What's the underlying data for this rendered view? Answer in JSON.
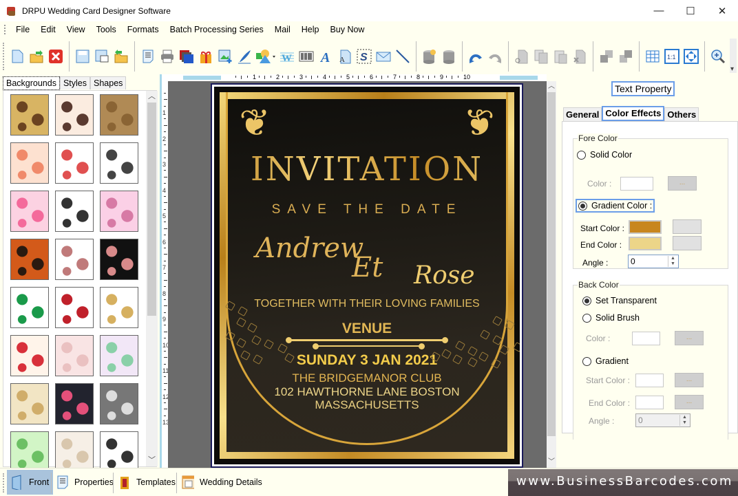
{
  "window": {
    "title": "DRPU Wedding Card Designer Software",
    "controls": {
      "minimize": "—",
      "maximize": "☐",
      "close": "✕"
    }
  },
  "menu": [
    "File",
    "Edit",
    "View",
    "Tools",
    "Formats",
    "Batch Processing Series",
    "Mail",
    "Help",
    "Buy Now"
  ],
  "toolbar": {
    "groups": [
      [
        "new-icon",
        "open-icon",
        "close-icon"
      ],
      [
        "save-icon",
        "save-as-icon",
        "export-icon"
      ],
      [
        "properties-icon",
        "print-icon",
        "print-batch-icon",
        "gift-icon",
        "insert-image-icon",
        "signature-icon",
        "shapes-icon",
        "watermark-icon",
        "barcode-icon",
        "text-icon",
        "text-file-icon",
        "symbol-icon",
        "email-icon",
        "line-icon"
      ],
      [
        "database-icon",
        "database-list-icon"
      ],
      [
        "undo-icon",
        "redo-icon"
      ],
      [
        "cut-icon",
        "copy-icon",
        "paste-icon",
        "delete-icon"
      ],
      [
        "bring-front-icon",
        "send-back-icon"
      ],
      [
        "grid-icon",
        "actual-size-icon",
        "fit-window-icon"
      ],
      [
        "zoom-in-icon"
      ]
    ]
  },
  "left_panel": {
    "tabs": [
      "Backgrounds",
      "Styles",
      "Shapes"
    ],
    "active_tab": "Backgrounds",
    "thumbnails": [
      {
        "name": "butterfly-gold",
        "colors": [
          "#d8b463",
          "#6b4320"
        ]
      },
      {
        "name": "paisley-lace",
        "colors": [
          "#fbece0",
          "#5a3a30"
        ]
      },
      {
        "name": "tan-tiles",
        "colors": [
          "#b08a55",
          "#8a6434"
        ]
      },
      {
        "name": "peach-flowers",
        "colors": [
          "#fde1d0",
          "#f08a6a"
        ]
      },
      {
        "name": "outline-hearts",
        "colors": [
          "#ffffff",
          "#e05050"
        ]
      },
      {
        "name": "palanquin-sketch",
        "colors": [
          "#ffffff",
          "#444444"
        ]
      },
      {
        "name": "pink-hearts",
        "colors": [
          "#fcd2e2",
          "#f46a9b"
        ]
      },
      {
        "name": "dancing-couples",
        "colors": [
          "#ffffff",
          "#333333"
        ]
      },
      {
        "name": "pink-swirls",
        "colors": [
          "#fbd0e6",
          "#d77aa5"
        ]
      },
      {
        "name": "orange-ganesha",
        "colors": [
          "#d35a1a",
          "#2a1a10"
        ]
      },
      {
        "name": "elephant-head",
        "colors": [
          "#ffffff",
          "#c07a7a"
        ]
      },
      {
        "name": "black-floral",
        "colors": [
          "#111111",
          "#d88a8a"
        ]
      },
      {
        "name": "leaf-ganesha",
        "colors": [
          "#ffffff",
          "#1a9a4a"
        ]
      },
      {
        "name": "rose-petals",
        "colors": [
          "#ffffff",
          "#c0202a"
        ]
      },
      {
        "name": "moon-star",
        "colors": [
          "#ffffff",
          "#d6b060"
        ]
      },
      {
        "name": "red-hearts",
        "colors": [
          "#fff4ea",
          "#d8303a"
        ]
      },
      {
        "name": "pale-pink-pattern",
        "colors": [
          "#f9e4e4",
          "#eac1c1"
        ]
      },
      {
        "name": "mandala",
        "colors": [
          "#f2e7f7",
          "#8ad0a8"
        ]
      },
      {
        "name": "white-rose-rings",
        "colors": [
          "#f2e5c4",
          "#d0ad6a"
        ]
      },
      {
        "name": "embroidered-flowers",
        "colors": [
          "#22232e",
          "#e4507a"
        ]
      },
      {
        "name": "grey-lace",
        "colors": [
          "#777777",
          "#dddddd"
        ]
      },
      {
        "name": "green-vines",
        "colors": [
          "#d2f5c6",
          "#6cc064"
        ]
      },
      {
        "name": "beige-marble",
        "colors": [
          "#f6efe6",
          "#d9c7ad"
        ]
      },
      {
        "name": "black-white-lace",
        "colors": [
          "#ffffff",
          "#333333"
        ]
      }
    ]
  },
  "ruler": {
    "horizontal": [
      "1",
      "2",
      "3",
      "4",
      "5",
      "6",
      "7",
      "8",
      "9",
      "10"
    ],
    "vertical": [
      "1",
      "2",
      "3",
      "4",
      "5",
      "6",
      "7",
      "8",
      "9",
      "10",
      "11",
      "12",
      "13"
    ]
  },
  "card": {
    "title": "INVITATION",
    "subtitle": "SAVE THE DATE",
    "groom": "Andrew",
    "conjunction": "Et",
    "bride": "Rose",
    "together": "TOGETHER WITH THEIR LOVING FAMILIES",
    "venue_label": "VENUE",
    "date": "SUNDAY 3 JAN 2021",
    "venue_name": "THE BRIDGEMANOR CLUB",
    "address": "102 HAWTHORNE LANE BOSTON",
    "state": "MASSACHUSETTS",
    "colors": {
      "gold": "#d7a230",
      "light_gold": "#efcd6f",
      "background": "#1e1b15"
    }
  },
  "right_panel": {
    "title": "Text Property",
    "tabs": [
      "General",
      "Color Effects",
      "Others"
    ],
    "active_tab": "Color Effects",
    "fore_color": {
      "label": "Fore Color",
      "solid_label": "Solid Color",
      "solid_selected": false,
      "color_label": "Color :",
      "browse_label": "...",
      "gradient_label": "Gradient Color :",
      "gradient_selected": true,
      "start_label": "Start Color :",
      "start_color": "#c8861e",
      "end_label": "End Color :",
      "end_color": "#ecd588",
      "angle_label": "Angle :",
      "angle_value": "0"
    },
    "back_color": {
      "label": "Back Color",
      "transparent_label": "Set Transparent",
      "transparent_selected": true,
      "solid_label": "Solid Brush",
      "color_label": "Color :",
      "browse_label": "...",
      "gradient_label": "Gradient",
      "start_label": "Start Color :",
      "end_label": "End Color :",
      "angle_label": "Angle :",
      "angle_value": "0"
    }
  },
  "bottom_tabs": [
    {
      "label": "Front",
      "icon": "card-front-icon",
      "active": true
    },
    {
      "label": "Properties",
      "icon": "properties-icon",
      "active": false
    },
    {
      "label": "Templates",
      "icon": "templates-icon",
      "active": false
    },
    {
      "label": "Wedding Details",
      "icon": "wedding-details-icon",
      "active": false
    }
  ],
  "watermark": "www.BusinessBarcodes.com"
}
